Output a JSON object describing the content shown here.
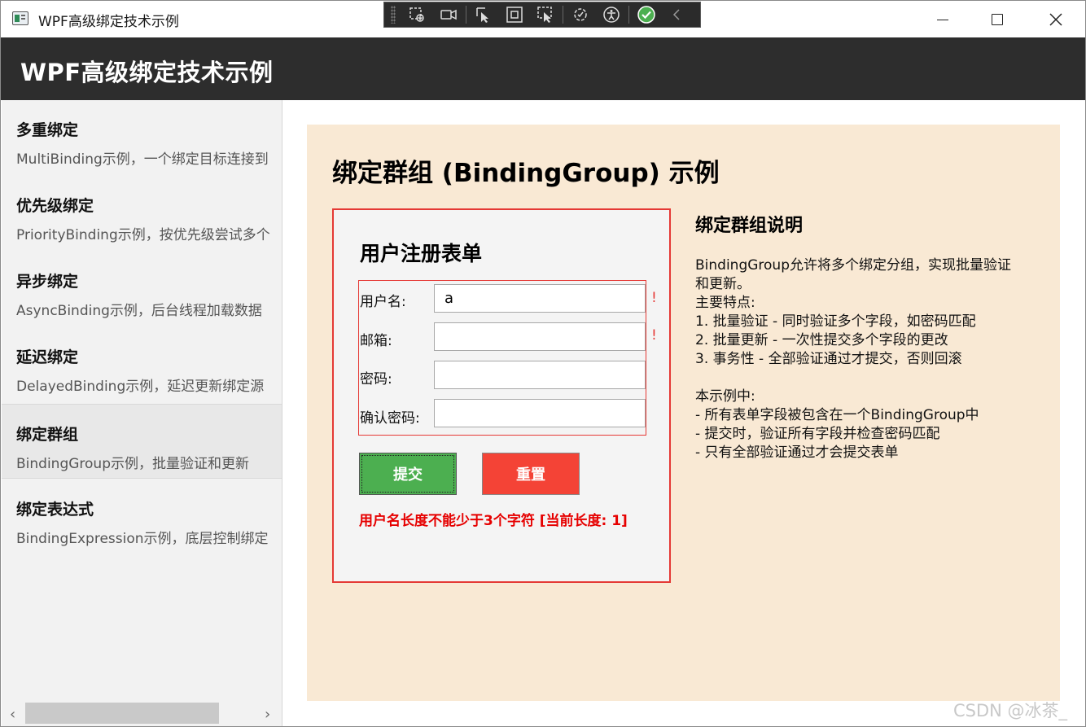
{
  "window": {
    "title": "WPF高级绑定技术示例"
  },
  "header": {
    "title": "WPF高级绑定技术示例"
  },
  "debug_toolbar": {
    "icons": [
      "grip-icon",
      "select-element-icon",
      "video-icon",
      "pointer-icon",
      "rectangle-select-icon",
      "track-focus-icon",
      "hot-reload-icon",
      "accessibility-icon",
      "check-circle-icon",
      "chevron-left-icon"
    ],
    "colors": {
      "background": "#2b2b2b",
      "check": "#4caf50"
    }
  },
  "sidebar": {
    "items": [
      {
        "title": "多重绑定",
        "desc": "MultiBinding示例，一个绑定目标连接到"
      },
      {
        "title": "优先级绑定",
        "desc": "PriorityBinding示例，按优先级尝试多个"
      },
      {
        "title": "异步绑定",
        "desc": "AsyncBinding示例，后台线程加载数据"
      },
      {
        "title": "延迟绑定",
        "desc": "DelayedBinding示例，延迟更新绑定源"
      },
      {
        "title": "绑定群组",
        "desc": "BindingGroup示例，批量验证和更新",
        "selected": true
      },
      {
        "title": "绑定表达式",
        "desc": "BindingExpression示例，底层控制绑定"
      }
    ],
    "scroll": {
      "left_arrow": "‹",
      "right_arrow": "›"
    }
  },
  "main": {
    "title": "绑定群组 (BindingGroup) 示例",
    "form": {
      "title": "用户注册表单",
      "fields": [
        {
          "label": "用户名:",
          "value": "a",
          "error_mark": "!"
        },
        {
          "label": "邮箱:",
          "value": "",
          "error_mark": "!"
        },
        {
          "label": "密码:",
          "value": "",
          "error_mark": ""
        },
        {
          "label": "确认密码:",
          "value": "",
          "error_mark": ""
        }
      ],
      "submit_label": "提交",
      "reset_label": "重置",
      "error_message": "用户名长度不能少于3个字符 [当前长度: 1]"
    },
    "description": {
      "title": "绑定群组说明",
      "lines": [
        "BindingGroup允许将多个绑定分组，实现批量验证",
        "和更新。",
        "主要特点:",
        "1. 批量验证 - 同时验证多个字段，如密码匹配",
        "2. 批量更新 - 一次性提交多个字段的更改",
        "3. 事务性 - 全部验证通过才提交，否则回滚",
        "",
        "本示例中:",
        "- 所有表单字段被包含在一个BindingGroup中",
        "- 提交时，验证所有字段并检查密码匹配",
        "- 只有全部验证通过才会提交表单"
      ]
    }
  },
  "watermark": "CSDN @冰茶_",
  "colors": {
    "header_bg": "#2d2d2d",
    "panel_bg": "#f9e9d4",
    "submit": "#4caf50",
    "reset": "#f44336",
    "error": "#e53935"
  }
}
